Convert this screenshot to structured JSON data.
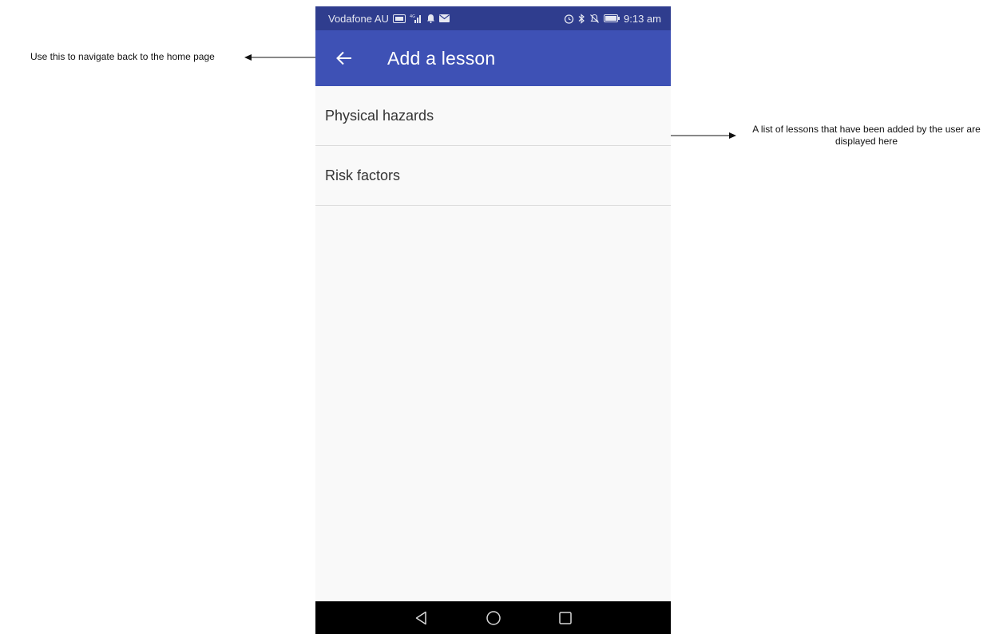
{
  "annotations": {
    "back_note": "Use this to navigate back to the home page",
    "list_note": "A list of lessons that have been added by the user are displayed here"
  },
  "status_bar": {
    "carrier": "Vodafone AU",
    "time": "9:13 am",
    "left_icons": [
      "volte-icon",
      "signal-icon",
      "notification-bell-icon",
      "mail-icon"
    ],
    "right_icons": [
      "alarm-icon",
      "bluetooth-icon",
      "vibrate-icon",
      "battery-icon"
    ]
  },
  "app_bar": {
    "title": "Add a lesson",
    "back_icon": "arrow-back-icon"
  },
  "lessons": [
    {
      "label": "Physical hazards"
    },
    {
      "label": "Risk factors"
    }
  ],
  "nav_bar": {
    "buttons": [
      "back-triangle-icon",
      "home-circle-icon",
      "recents-square-icon"
    ]
  },
  "colors": {
    "status_bar": "#2f3d8e",
    "app_bar": "#3e51b5",
    "list_background": "#f9f9f9",
    "nav_bar": "#000000"
  }
}
